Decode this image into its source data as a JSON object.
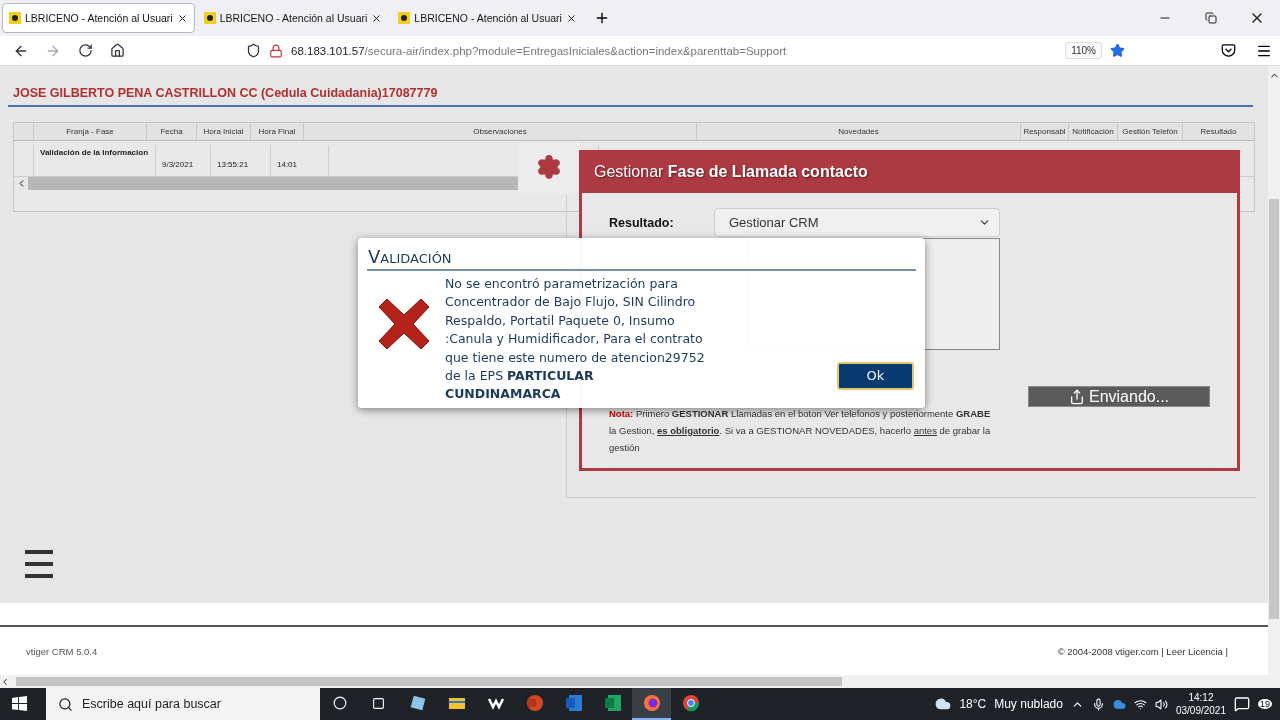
{
  "browser": {
    "tabs": [
      {
        "title": "LBRICENO - Atención al Usuari",
        "selected": true
      },
      {
        "title": "LBRICENO - Atención al Usuari",
        "selected": false
      },
      {
        "title": "LBRICENO - Atención al Usuari",
        "selected": false
      }
    ],
    "url": {
      "host": "68.183.101.57",
      "path": "/secura-air/index.php?module=EntregasIniciales&action=index&parenttab=Support"
    },
    "zoom": "110%"
  },
  "page": {
    "patient": "JOSE GILBERTO PENA CASTRILLON CC (Cedula Cuidadania)17087779",
    "table": {
      "columns": [
        "",
        "Franja - Fase",
        "Fecha",
        "Hora Inicial",
        "Hora Final",
        "Observaciones",
        "Novedades",
        "Responsabl",
        "Notificación",
        "Gestión Telefón",
        "Resultado"
      ],
      "rows": [
        [
          "",
          "Validación de la Informacion",
          "9/3/2021",
          "13:55:21",
          "14:01"
        ]
      ]
    },
    "panel": {
      "title_prefix": "Gestionar",
      "title_bold": "Fase de Llamada contacto",
      "result_label": "Resultado:",
      "result_value": "Gestionar CRM",
      "sending_button": "Enviando...",
      "note": [
        {
          "kind": "label",
          "text": "Nota:"
        },
        {
          "kind": "plain",
          "text": " Primero "
        },
        {
          "kind": "strong",
          "text": "GESTIONAR"
        },
        {
          "kind": "plain",
          "text": " Llamadas en el boton Ver telefonos y posteriormente "
        },
        {
          "kind": "strong",
          "text": "GRABE"
        },
        {
          "kind": "plain",
          "text": " la Gestion, "
        },
        {
          "kind": "strongunder",
          "text": "es obligatorio"
        },
        {
          "kind": "plain",
          "text": ". Si va a GESTIONAR NOVEDADES, hacerlo "
        },
        {
          "kind": "under",
          "text": "antes"
        },
        {
          "kind": "plain",
          "text": " de grabar la gestión"
        }
      ]
    },
    "dialog": {
      "title": "Validación",
      "message": "No se encontró parametrización para Concentrador de Bajo Flujo, SIN Cilindro Respaldo, Portatil Paquete 0, Insumo :Canula y Humidificador, Para el contrato que tiene este numero de atencion29752 de la EPS **PARTICULAR CUNDINAMARCA**",
      "ok": "Ok"
    }
  },
  "footer": {
    "version": "vtiger CRM 5.0.4",
    "copyright": "© 2004-2008 vtiger.com | Leer Licencia |"
  },
  "taskbar": {
    "search_placeholder": "Escribe aquí para buscar",
    "temperature": "18°C",
    "weather": "Muy nublado",
    "time": "14:12",
    "date": "03/09/2021",
    "notifications": "19"
  }
}
